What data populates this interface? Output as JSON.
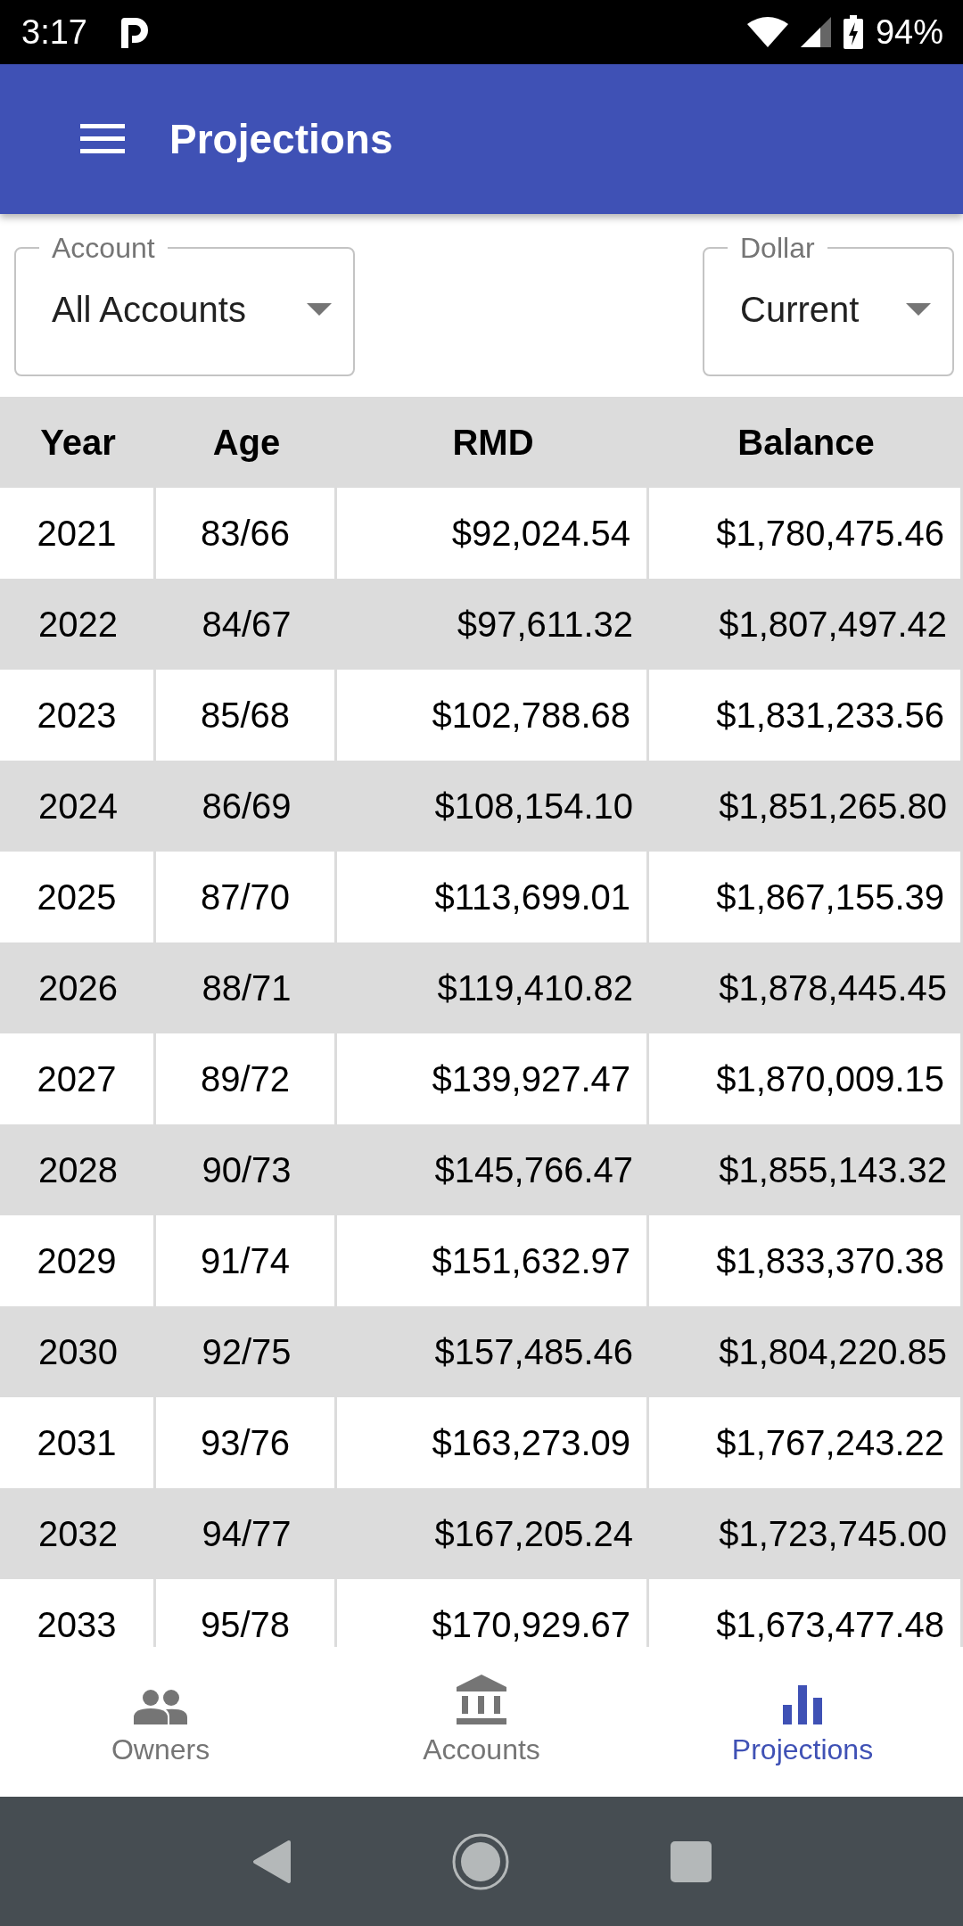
{
  "status_bar": {
    "time": "3:17",
    "battery": "94%"
  },
  "app_bar": {
    "title": "Projections"
  },
  "filters": [
    {
      "label": "Account",
      "value": "All Accounts"
    },
    {
      "label": "Dollar",
      "value": "Current"
    }
  ],
  "table": {
    "columns": [
      "Year",
      "Age",
      "RMD",
      "Balance"
    ],
    "rows": [
      [
        "2021",
        "83/66",
        "$92,024.54",
        "$1,780,475.46"
      ],
      [
        "2022",
        "84/67",
        "$97,611.32",
        "$1,807,497.42"
      ],
      [
        "2023",
        "85/68",
        "$102,788.68",
        "$1,831,233.56"
      ],
      [
        "2024",
        "86/69",
        "$108,154.10",
        "$1,851,265.80"
      ],
      [
        "2025",
        "87/70",
        "$113,699.01",
        "$1,867,155.39"
      ],
      [
        "2026",
        "88/71",
        "$119,410.82",
        "$1,878,445.45"
      ],
      [
        "2027",
        "89/72",
        "$139,927.47",
        "$1,870,009.15"
      ],
      [
        "2028",
        "90/73",
        "$145,766.47",
        "$1,855,143.32"
      ],
      [
        "2029",
        "91/74",
        "$151,632.97",
        "$1,833,370.38"
      ],
      [
        "2030",
        "92/75",
        "$157,485.46",
        "$1,804,220.85"
      ],
      [
        "2031",
        "93/76",
        "$163,273.09",
        "$1,767,243.22"
      ],
      [
        "2032",
        "94/77",
        "$167,205.24",
        "$1,723,745.00"
      ],
      [
        "2033",
        "95/78",
        "$170,929.67",
        "$1,673,477.48"
      ]
    ]
  },
  "bottom_nav": [
    {
      "kind": "owners",
      "label": "Owners",
      "selected": false
    },
    {
      "kind": "accounts",
      "label": "Accounts",
      "selected": false
    },
    {
      "kind": "projections",
      "label": "Projections",
      "selected": true
    }
  ]
}
